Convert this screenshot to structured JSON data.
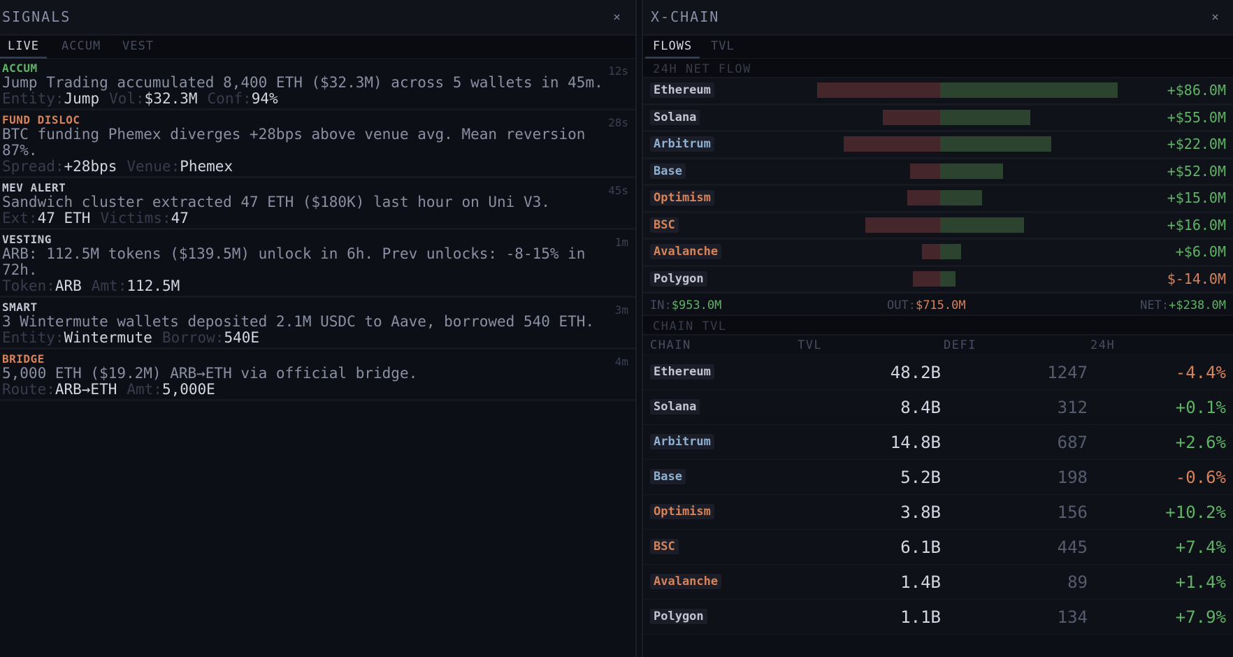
{
  "colors": {
    "green": "#5fb364",
    "orange": "#d6835a",
    "red": "#d6835a",
    "label": "#383c4c",
    "value": "#d4d7e2",
    "cat_default": "#c3c6d3"
  },
  "signals": {
    "title": "SIGNALS",
    "close_icon": "×",
    "tabs": [
      {
        "label": "LIVE",
        "active": true
      },
      {
        "label": "ACCUM",
        "active": false
      },
      {
        "label": "VEST",
        "active": false
      }
    ],
    "items": [
      {
        "category": "ACCUM",
        "cat_color": "#5fb364",
        "time": "12s",
        "text": "Jump Trading accumulated 8,400 ETH ($32.3M) across 5 wallets in 45m.",
        "meta": [
          {
            "label": "Entity:",
            "value": "Jump"
          },
          {
            "label": "Vol:",
            "value": "$32.3M"
          },
          {
            "label": "Conf:",
            "value": "94%"
          }
        ]
      },
      {
        "category": "FUND DISLOC",
        "cat_color": "#d6835a",
        "time": "28s",
        "text": "BTC funding Phemex diverges +28bps above venue avg. Mean reversion 87%.",
        "meta": [
          {
            "label": "Spread:",
            "value": "+28bps"
          },
          {
            "label": "Venue:",
            "value": "Phemex"
          }
        ]
      },
      {
        "category": "MEV ALERT",
        "cat_color": "#c3c6d3",
        "time": "45s",
        "text": "Sandwich cluster extracted 47 ETH ($180K) last hour on Uni V3.",
        "meta": [
          {
            "label": "Ext:",
            "value": "47 ETH"
          },
          {
            "label": "Victims:",
            "value": "47"
          }
        ]
      },
      {
        "category": "VESTING",
        "cat_color": "#c3c6d3",
        "time": "1m",
        "text": "ARB: 112.5M tokens ($139.5M) unlock in 6h. Prev unlocks: -8-15% in 72h.",
        "meta": [
          {
            "label": "Token:",
            "value": "ARB"
          },
          {
            "label": "Amt:",
            "value": "112.5M"
          }
        ]
      },
      {
        "category": "SMART",
        "cat_color": "#c3c6d3",
        "time": "3m",
        "text": "3 Wintermute wallets deposited 2.1M USDC to Aave, borrowed 540 ETH.",
        "meta": [
          {
            "label": "Entity:",
            "value": "Wintermute"
          },
          {
            "label": "Borrow:",
            "value": "540E"
          }
        ]
      },
      {
        "category": "BRIDGE",
        "cat_color": "#d6835a",
        "time": "4m",
        "text": "5,000 ETH ($19.2M) ARB→ETH via official bridge.",
        "meta": [
          {
            "label": "Route:",
            "value": "ARB→ETH"
          },
          {
            "label": "Amt:",
            "value": "5,000E"
          }
        ]
      }
    ]
  },
  "xchain": {
    "title": "X-CHAIN",
    "close_icon": "×",
    "tabs": [
      {
        "label": "FLOWS",
        "active": true
      },
      {
        "label": "TVL",
        "active": false
      }
    ],
    "flow_label": "24H NET FLOW",
    "flows": [
      {
        "chain": "Ethereum",
        "chip_color": "#c3c6d3",
        "out": 0.41,
        "in": 0.59,
        "net": "+$86.0M",
        "positive": true
      },
      {
        "chain": "Solana",
        "chip_color": "#c3c6d3",
        "out": 0.19,
        "in": 0.3,
        "net": "+$55.0M",
        "positive": true
      },
      {
        "chain": "Arbitrum",
        "chip_color": "#8fb0d0",
        "out": 0.32,
        "in": 0.37,
        "net": "+$22.0M",
        "positive": true
      },
      {
        "chain": "Base",
        "chip_color": "#8fb0d0",
        "out": 0.1,
        "in": 0.21,
        "net": "+$52.0M",
        "positive": true
      },
      {
        "chain": "Optimism",
        "chip_color": "#d6835a",
        "out": 0.11,
        "in": 0.14,
        "net": "+$15.0M",
        "positive": true
      },
      {
        "chain": "BSC",
        "chip_color": "#d6835a",
        "out": 0.25,
        "in": 0.28,
        "net": "+$16.0M",
        "positive": true
      },
      {
        "chain": "Avalanche",
        "chip_color": "#d6835a",
        "out": 0.06,
        "in": 0.07,
        "net": "+$6.0M",
        "positive": true
      },
      {
        "chain": "Polygon",
        "chip_color": "#c3c6d3",
        "out": 0.09,
        "in": 0.05,
        "net": "$-14.0M",
        "positive": false
      }
    ],
    "totals": {
      "in_label": "IN:",
      "in_value": "$953.0M",
      "out_label": "OUT:",
      "out_value": "$715.0M",
      "net_label": "NET:",
      "net_value": "+$238.0M"
    },
    "tvl_label": "CHAIN TVL",
    "tvl_headers": {
      "chain": "CHAIN",
      "tvl": "TVL",
      "defi": "DEFI",
      "change": "24H"
    },
    "tvl": [
      {
        "chain": "Ethereum",
        "chip_color": "#c3c6d3",
        "tvl": "48.2B",
        "defi": "1247",
        "change": "-4.4%",
        "positive": false
      },
      {
        "chain": "Solana",
        "chip_color": "#c3c6d3",
        "tvl": "8.4B",
        "defi": "312",
        "change": "+0.1%",
        "positive": true
      },
      {
        "chain": "Arbitrum",
        "chip_color": "#8fb0d0",
        "tvl": "14.8B",
        "defi": "687",
        "change": "+2.6%",
        "positive": true
      },
      {
        "chain": "Base",
        "chip_color": "#8fb0d0",
        "tvl": "5.2B",
        "defi": "198",
        "change": "-0.6%",
        "positive": false
      },
      {
        "chain": "Optimism",
        "chip_color": "#d6835a",
        "tvl": "3.8B",
        "defi": "156",
        "change": "+10.2%",
        "positive": true
      },
      {
        "chain": "BSC",
        "chip_color": "#d6835a",
        "tvl": "6.1B",
        "defi": "445",
        "change": "+7.4%",
        "positive": true
      },
      {
        "chain": "Avalanche",
        "chip_color": "#d6835a",
        "tvl": "1.4B",
        "defi": "89",
        "change": "+1.4%",
        "positive": true
      },
      {
        "chain": "Polygon",
        "chip_color": "#c3c6d3",
        "tvl": "1.1B",
        "defi": "134",
        "change": "+7.9%",
        "positive": true
      }
    ]
  }
}
